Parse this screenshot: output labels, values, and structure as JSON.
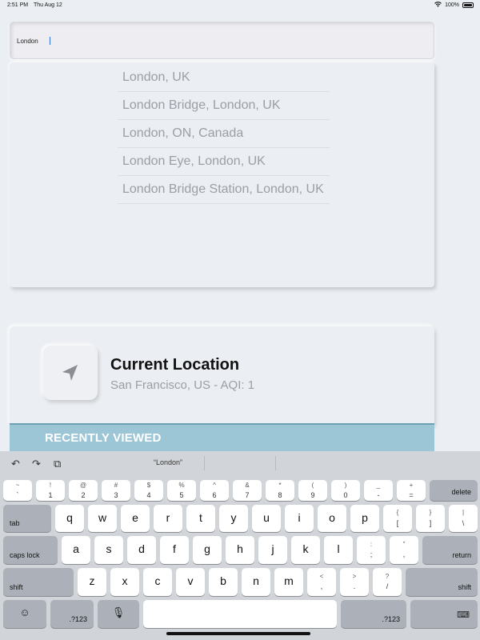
{
  "status_bar": {
    "time": "2:51 PM",
    "date": "Thu Aug 12",
    "wifi_icon": "wifi-icon",
    "battery": "100%"
  },
  "search": {
    "value": "London"
  },
  "suggestions": [
    "London, UK",
    "London Bridge, London, UK",
    "London, ON, Canada",
    "London Eye, London, UK",
    "London Bridge Station, London, UK"
  ],
  "current_location": {
    "title": "Current Location",
    "subtitle": "San Francisco, US - AQI: 1",
    "icon": "location-arrow-icon"
  },
  "recently_viewed": {
    "label": "RECENTLY VIEWED"
  },
  "keyboard": {
    "toolbar": {
      "undo_icon": "undo-icon",
      "redo_icon": "redo-icon",
      "paste_icon": "paste-icon",
      "prediction": "“London”"
    },
    "number_row": [
      {
        "top": "~",
        "bottom": "`"
      },
      {
        "top": "!",
        "bottom": "1"
      },
      {
        "top": "@",
        "bottom": "2"
      },
      {
        "top": "#",
        "bottom": "3"
      },
      {
        "top": "$",
        "bottom": "4"
      },
      {
        "top": "%",
        "bottom": "5"
      },
      {
        "top": "^",
        "bottom": "6"
      },
      {
        "top": "&",
        "bottom": "7"
      },
      {
        "top": "*",
        "bottom": "8"
      },
      {
        "top": "(",
        "bottom": "9"
      },
      {
        "top": ")",
        "bottom": "0"
      },
      {
        "top": "_",
        "bottom": "-"
      },
      {
        "top": "+",
        "bottom": "="
      }
    ],
    "delete": "delete",
    "tab": "tab",
    "row_q": [
      "q",
      "w",
      "e",
      "r",
      "t",
      "y",
      "u",
      "i",
      "o",
      "p"
    ],
    "row_q_sym": [
      {
        "top": "{",
        "bottom": "["
      },
      {
        "top": "}",
        "bottom": "]"
      },
      {
        "top": "|",
        "bottom": "\\"
      }
    ],
    "caps_lock": "caps lock",
    "row_a": [
      "a",
      "s",
      "d",
      "f",
      "g",
      "h",
      "j",
      "k",
      "l"
    ],
    "row_a_sym": [
      {
        "top": ":",
        "bottom": ";"
      },
      {
        "top": "”",
        "bottom": ","
      }
    ],
    "return": "return",
    "shift": "shift",
    "row_z": [
      "z",
      "x",
      "c",
      "v",
      "b",
      "n",
      "m"
    ],
    "row_z_sym": [
      {
        "top": "<",
        "bottom": ","
      },
      {
        "top": ">",
        "bottom": "."
      },
      {
        "top": "?",
        "bottom": "/"
      }
    ],
    "emoji_icon": "emoji-icon",
    "num_key": ".?123",
    "mic_icon": "microphone-icon",
    "hide_keyboard_icon": "keyboard-hide-icon"
  }
}
